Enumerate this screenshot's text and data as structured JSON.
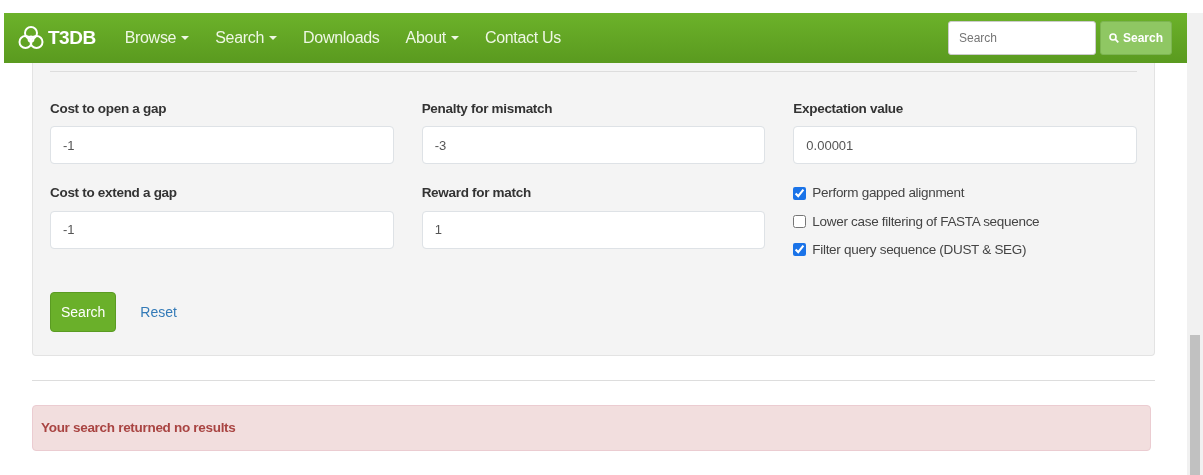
{
  "navbar": {
    "brand": "T3DB",
    "items": [
      {
        "label": "Browse",
        "dropdown": true
      },
      {
        "label": "Search",
        "dropdown": true
      },
      {
        "label": "Downloads",
        "dropdown": false
      },
      {
        "label": "About",
        "dropdown": true
      },
      {
        "label": "Contact Us",
        "dropdown": false
      }
    ],
    "search": {
      "placeholder": "Search",
      "button": "Search"
    }
  },
  "form": {
    "fields": [
      {
        "label": "Cost to open a gap",
        "value": "-1"
      },
      {
        "label": "Penalty for mismatch",
        "value": "-3"
      },
      {
        "label": "Expectation value",
        "value": "0.00001"
      },
      {
        "label": "Cost to extend a gap",
        "value": "-1"
      },
      {
        "label": "Reward for match",
        "value": "1"
      }
    ],
    "options": [
      {
        "label": "Perform gapped alignment",
        "checked": true
      },
      {
        "label": "Lower case filtering of FASTA sequence",
        "checked": false
      },
      {
        "label": "Filter query sequence (DUST & SEG)",
        "checked": true
      }
    ],
    "submit": "Search",
    "reset": "Reset"
  },
  "alert": "Your search returned no results"
}
